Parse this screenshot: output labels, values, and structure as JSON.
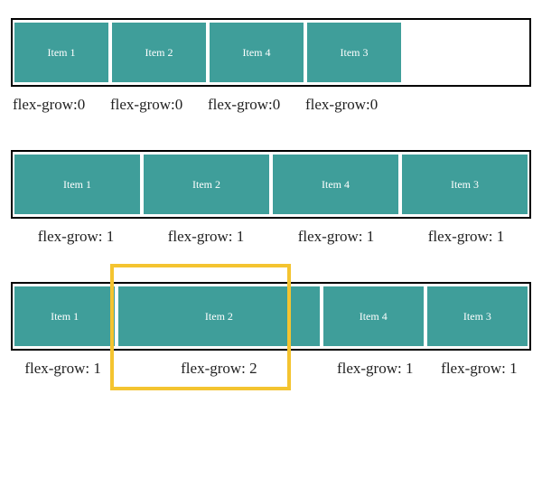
{
  "examples": [
    {
      "items": [
        "Item 1",
        "Item 2",
        "Item 4",
        "Item 3"
      ],
      "labels": [
        "flex-grow:0",
        "flex-grow:0",
        "flex-grow:0",
        "flex-grow:0"
      ]
    },
    {
      "items": [
        "Item 1",
        "Item 2",
        "Item 4",
        "Item 3"
      ],
      "labels": [
        "flex-grow: 1",
        "flex-grow: 1",
        "flex-grow: 1",
        "flex-grow: 1"
      ]
    },
    {
      "items": [
        "Item 1",
        "Item 2",
        "Item 4",
        "Item 3"
      ],
      "labels": [
        "flex-grow: 1",
        "flex-grow: 2",
        "flex-grow: 1",
        "flex-grow: 1"
      ]
    }
  ]
}
